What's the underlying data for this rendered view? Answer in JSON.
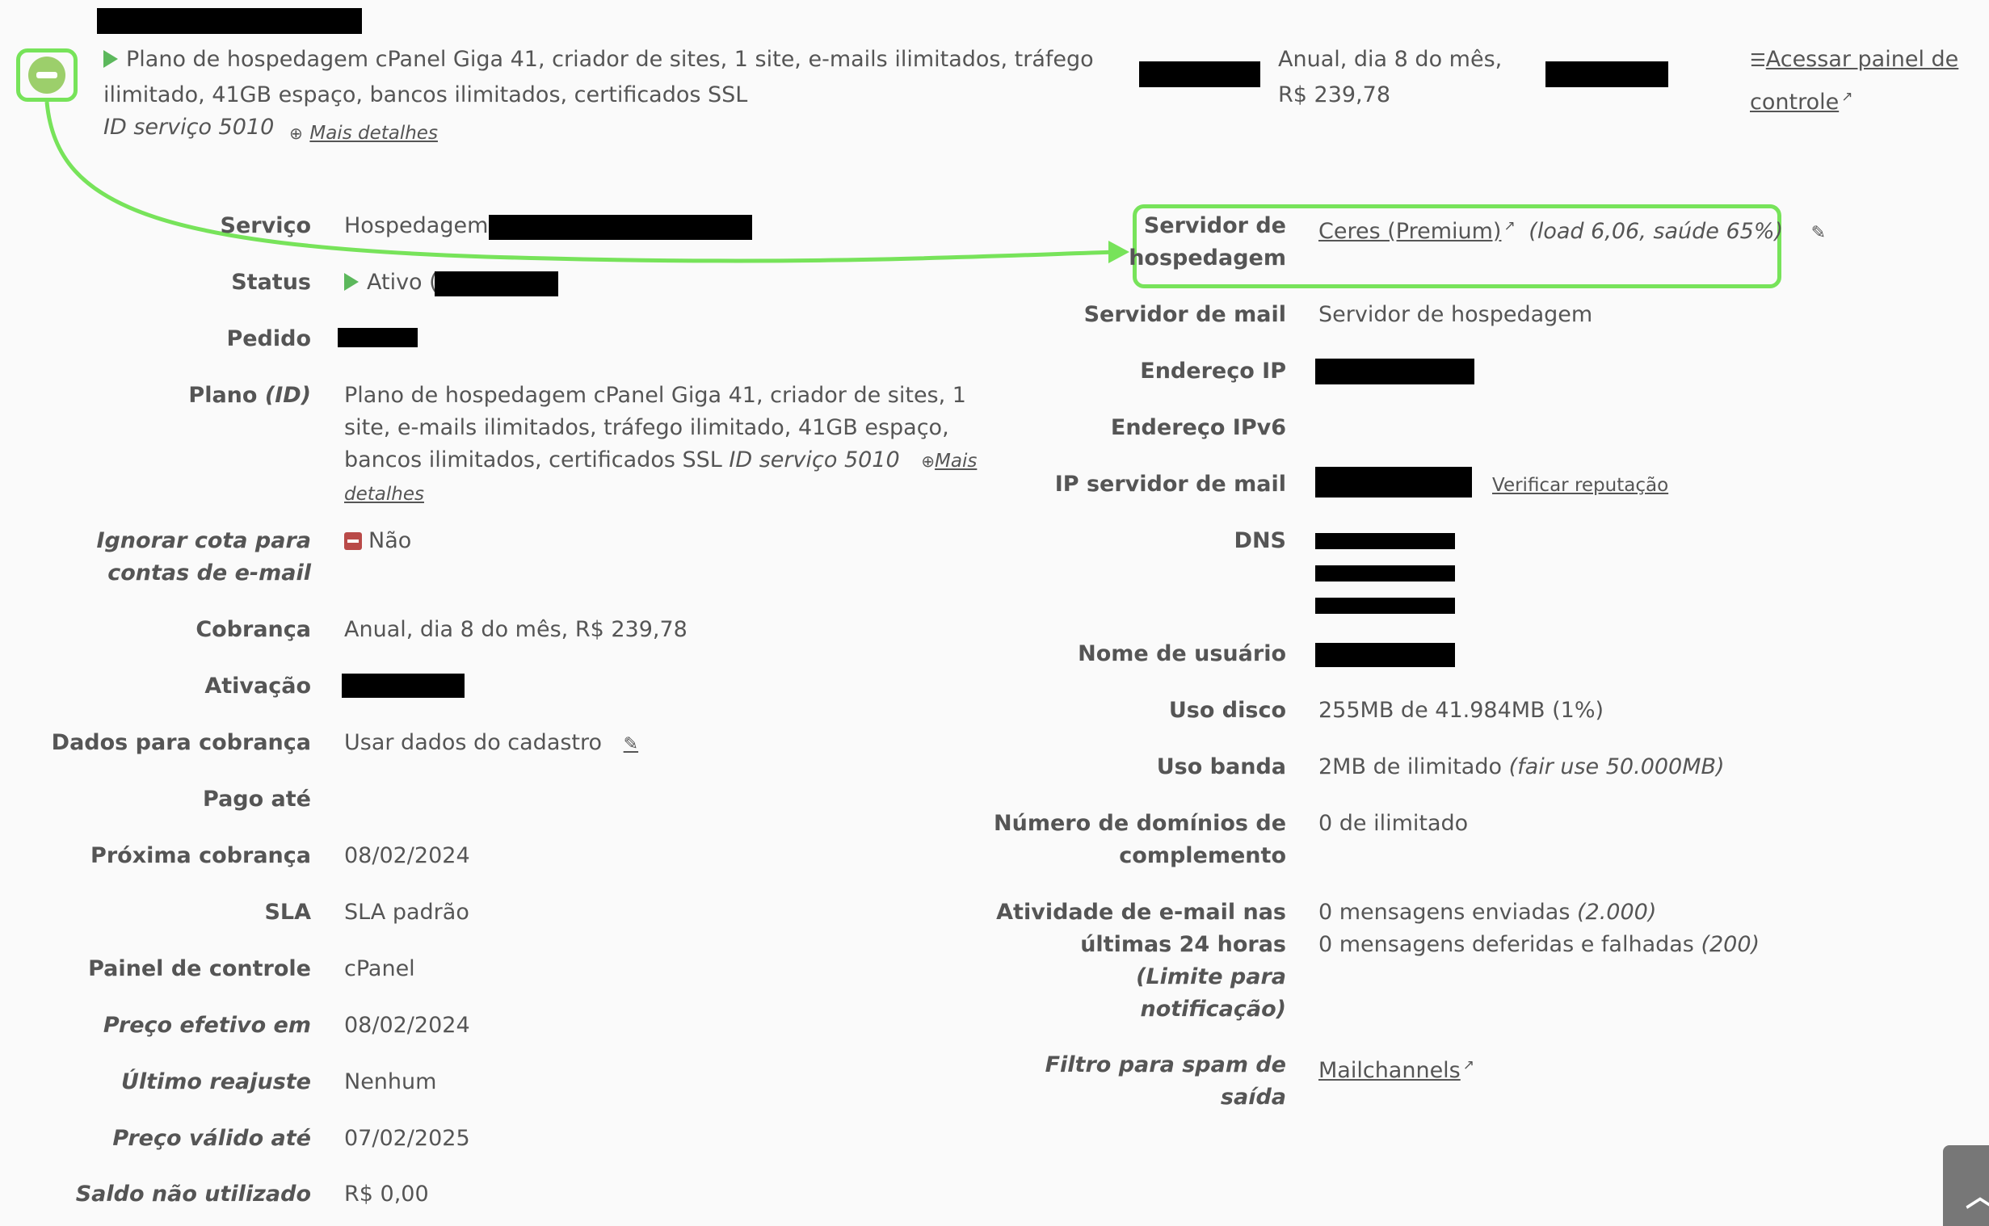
{
  "header": {
    "plan_text_line1": "Plano de hospedagem cPanel Giga 41, criador de sites, 1 site, e-mails ilimitados, tráfego",
    "plan_text_line2": "ilimitado, 41GB espaço, bancos ilimitados, certificados SSL",
    "service_id": "ID serviço 5010",
    "more_details": "Mais detalhes",
    "billing_line1": "Anual, dia 8 do mês,",
    "billing_line2": "R$ 239,78",
    "control_panel_line1": "Acessar painel de",
    "control_panel_line2": "controle"
  },
  "left": {
    "servico": {
      "label": "Serviço",
      "value": "Hospedagem"
    },
    "status": {
      "label": "Status",
      "value": "Ativo ("
    },
    "pedido": {
      "label": "Pedido"
    },
    "plano": {
      "label": "Plano",
      "label_suffix": "(ID)",
      "line1": "Plano de hospedagem cPanel Giga 41, criador de sites, 1",
      "line2": "site, e-mails ilimitados, tráfego ilimitado, 41GB espaço,",
      "line3": "bancos ilimitados, certificados SSL",
      "service_id": "ID serviço 5010",
      "more_1": "Mais",
      "more_2": "detalhes"
    },
    "ignorar": {
      "label_line1": "Ignorar cota para",
      "label_line2": "contas de e-mail",
      "value": "Não"
    },
    "cobranca": {
      "label": "Cobrança",
      "value": "Anual, dia 8 do mês, R$ 239,78"
    },
    "ativacao": {
      "label": "Ativação"
    },
    "dados_cobranca": {
      "label": "Dados para cobrança",
      "value": "Usar dados do cadastro"
    },
    "pago_ate": {
      "label": "Pago até"
    },
    "proxima_cobranca": {
      "label": "Próxima cobrança",
      "value": "08/02/2024"
    },
    "sla": {
      "label": "SLA",
      "value": "SLA padrão"
    },
    "painel": {
      "label": "Painel de controle",
      "value": "cPanel"
    },
    "preco_efetivo": {
      "label": "Preço efetivo em",
      "value": "08/02/2024"
    },
    "ultimo_reajuste": {
      "label": "Último reajuste",
      "value": "Nenhum"
    },
    "preco_valido": {
      "label": "Preço válido até",
      "value": "07/02/2025"
    },
    "saldo": {
      "label": "Saldo não utilizado",
      "value": "R$ 0,00"
    }
  },
  "right": {
    "servidor_hospedagem": {
      "label_line1": "Servidor de",
      "label_line2": "hospedagem",
      "link": "Ceres (Premium)",
      "extra": "(load 6,06, saúde 65%)"
    },
    "servidor_mail": {
      "label": "Servidor de mail",
      "value": "Servidor de hospedagem"
    },
    "endereco_ip": {
      "label": "Endereço IP"
    },
    "endereco_ipv6": {
      "label": "Endereço IPv6"
    },
    "ip_mail": {
      "label": "IP servidor de mail",
      "link": "Verificar reputação"
    },
    "dns": {
      "label": "DNS"
    },
    "usuario": {
      "label": "Nome de usuário"
    },
    "uso_disco": {
      "label": "Uso disco",
      "value": "255MB de 41.984MB (1%)"
    },
    "uso_banda": {
      "label": "Uso banda",
      "value": "2MB de ilimitado",
      "extra": "(fair use 50.000MB)"
    },
    "dominios": {
      "label_line1": "Número de domínios de",
      "label_line2": "complemento",
      "value": "0 de ilimitado"
    },
    "atividade": {
      "label_line1": "Atividade de e-mail nas",
      "label_line2": "últimas 24 horas",
      "label_line3": "(Limite para",
      "label_line4": "notificação)",
      "value1": "0 mensagens enviadas",
      "value1_extra": "(2.000)",
      "value2": "0 mensagens deferidas e falhadas",
      "value2_extra": "(200)"
    },
    "filtro_spam": {
      "label_line1": "Filtro para spam de",
      "label_line2": "saída",
      "link": "Mailchannels"
    }
  },
  "colors": {
    "highlight": "#77e35a",
    "active": "#5cb85c",
    "negative": "#b94a48",
    "text": "#555555"
  },
  "icons": [
    "collapse-icon",
    "play-icon",
    "zoom-icon",
    "external-link-icon",
    "edit-icon",
    "sliders-icon",
    "chevron-up-icon"
  ]
}
